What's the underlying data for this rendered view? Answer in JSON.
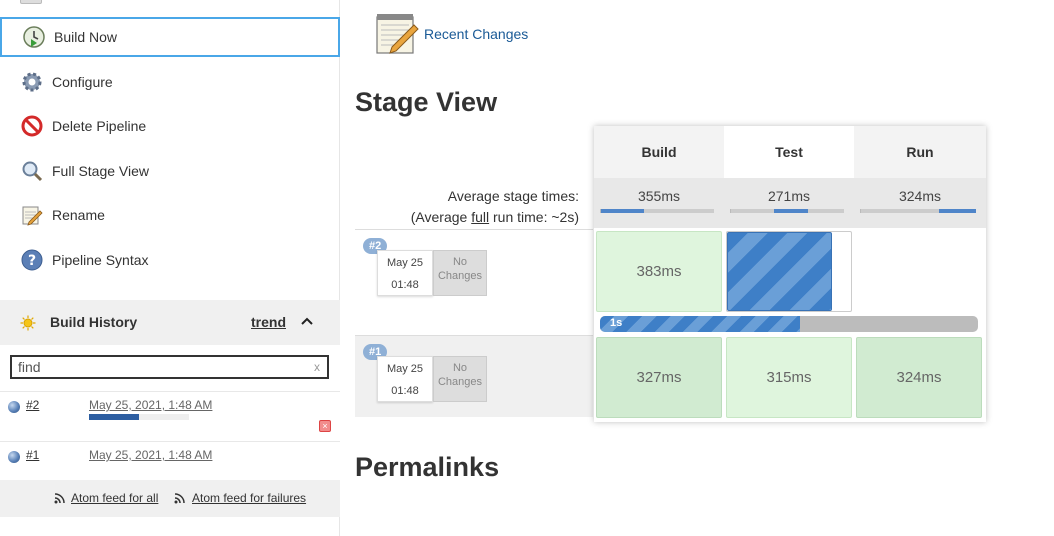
{
  "sidebar": {
    "tasks": [
      {
        "label": "Build Now",
        "icon": "clock-play-icon"
      },
      {
        "label": "Configure",
        "icon": "gear-icon"
      },
      {
        "label": "Delete Pipeline",
        "icon": "no-entry-icon"
      },
      {
        "label": "Full Stage View",
        "icon": "magnifier-icon"
      },
      {
        "label": "Rename",
        "icon": "notepad-pencil-icon"
      },
      {
        "label": "Pipeline Syntax",
        "icon": "help-icon"
      }
    ],
    "active_task": "Build Now"
  },
  "build_history": {
    "title": "Build History",
    "trend_label": "trend",
    "search": {
      "value": "find",
      "clear_label": "x"
    },
    "builds": [
      {
        "number": "#2",
        "date": "May 25, 2021, 1:48 AM",
        "in_progress": true,
        "progress": 0.5
      },
      {
        "number": "#1",
        "date": "May 25, 2021, 1:48 AM",
        "in_progress": false
      }
    ],
    "feeds": {
      "all_label": "Atom feed for all",
      "failures_label": "Atom feed for failures"
    }
  },
  "main": {
    "recent_changes_label": "Recent Changes",
    "stage_view_title": "Stage View",
    "permalinks_title": "Permalinks",
    "avg_label": "Average stage times:",
    "avg_full_prefix": "(Average ",
    "avg_full_link": "full",
    "avg_full_suffix": " run time: ~2s)",
    "stages": [
      {
        "name": "Build",
        "avg": "355ms",
        "avg_bar": [
          0.0,
          0.38
        ]
      },
      {
        "name": "Test",
        "avg": "271ms",
        "avg_bar": [
          0.38,
          0.68
        ]
      },
      {
        "name": "Run",
        "avg": "324ms",
        "avg_bar": [
          0.68,
          1.0
        ]
      }
    ],
    "runs": [
      {
        "badge": "#2",
        "month_day": "May 25",
        "time": "01:48",
        "changes": "No Changes",
        "cells": [
          "383ms",
          "",
          ""
        ],
        "progress_label": "1s",
        "progress": 0.53
      },
      {
        "badge": "#1",
        "month_day": "May 25",
        "time": "01:48",
        "changes": "No Changes",
        "cells": [
          "327ms",
          "315ms",
          "324ms"
        ]
      }
    ]
  },
  "colors": {
    "accent_border": "#4aa7e8",
    "link": "#1a5a96",
    "success": "#dff5dd",
    "running": "#3e7fc7"
  }
}
